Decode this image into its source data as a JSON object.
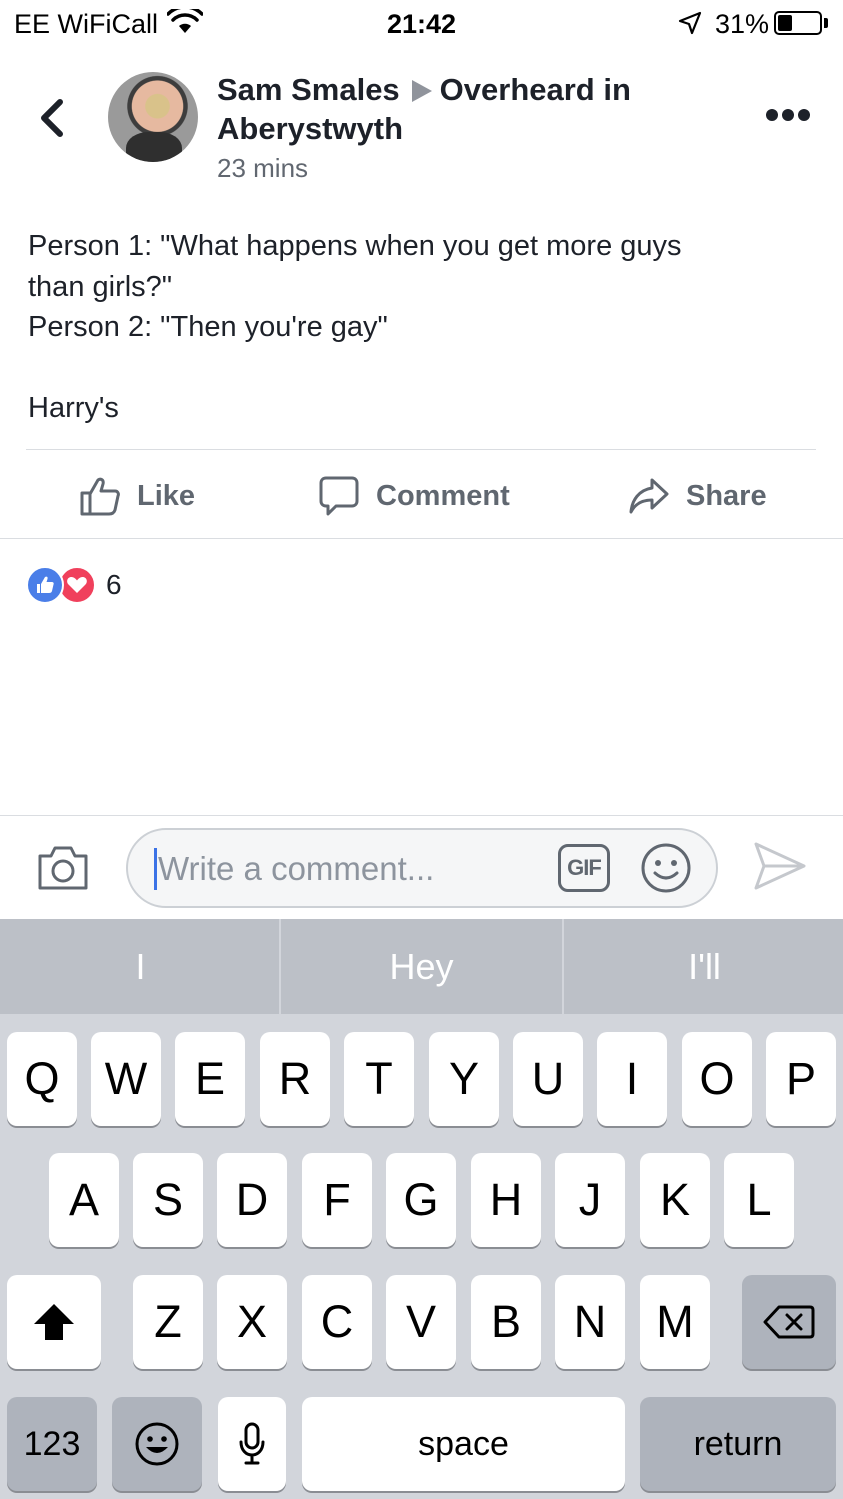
{
  "status_bar": {
    "carrier": "EE WiFiCall",
    "time": "21:42",
    "battery": "31%"
  },
  "post": {
    "author": "Sam Smales",
    "group_line1": "Overheard in",
    "group_line2": "Aberystwyth",
    "timestamp": "23 mins",
    "body": [
      "Person 1: \"What happens when you get more guys",
      "than girls?\"",
      "Person 2: \"Then you're gay\"",
      "",
      "Harry's"
    ]
  },
  "actions": {
    "like": "Like",
    "comment": "Comment",
    "share": "Share"
  },
  "reactions": {
    "count": "6",
    "types": [
      "like",
      "love"
    ]
  },
  "comment_bar": {
    "placeholder": "Write a comment...",
    "gif_label": "GIF"
  },
  "keyboard": {
    "suggestions": [
      "I",
      "Hey",
      "I'll"
    ],
    "row1": [
      "Q",
      "W",
      "E",
      "R",
      "T",
      "Y",
      "U",
      "I",
      "O",
      "P"
    ],
    "row2": [
      "A",
      "S",
      "D",
      "F",
      "G",
      "H",
      "J",
      "K",
      "L"
    ],
    "row3": [
      "Z",
      "X",
      "C",
      "V",
      "B",
      "N",
      "M"
    ],
    "numbers_key": "123",
    "space_key": "space",
    "return_key": "return"
  },
  "colors": {
    "facebook_blue": "#4a7ee8",
    "love_red": "#f0405c",
    "secondary_text": "#606770"
  }
}
